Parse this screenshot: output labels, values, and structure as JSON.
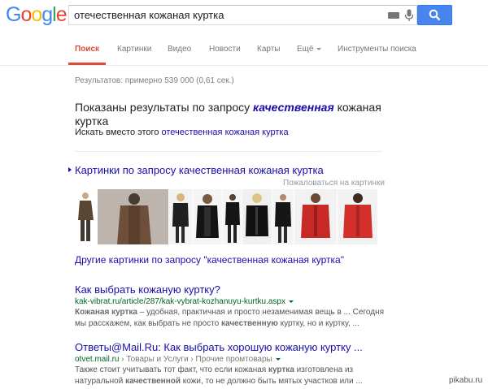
{
  "header": {
    "logo_text": "Google",
    "logo_colors": [
      "#4285f4",
      "#ea4335",
      "#fbbc05",
      "#4285f4",
      "#34a853",
      "#ea4335"
    ],
    "search_query": "отечественная кожаная куртка",
    "keyboard_icon": "keyboard-icon",
    "mic_icon": "microphone-icon",
    "search_button_icon": "magnifier-icon",
    "accent": "#4885ed"
  },
  "nav": {
    "items": [
      {
        "label": "Поиск",
        "active": true
      },
      {
        "label": "Картинки"
      },
      {
        "label": "Видео"
      },
      {
        "label": "Новости"
      },
      {
        "label": "Карты"
      },
      {
        "label": "Ещё"
      },
      {
        "label": "Инструменты поиска"
      }
    ],
    "active_color": "#dd4b39"
  },
  "stats": "Результатов: примерно 539 000 (0,61 сек.)",
  "spelling": {
    "prefix": "Показаны результаты по запросу",
    "corrected_word": "качественная",
    "suffix": "кожаная куртка",
    "instead_prefix": "Искать вместо этого",
    "instead_link": "отечественная кожаная куртка"
  },
  "images_block": {
    "title": "Картинки по запросу качественная кожаная куртка",
    "report": "Пожаловаться на картинки",
    "more_link": "Другие картинки по запросу \"качественная кожаная куртка\""
  },
  "results": [
    {
      "title": "Как выбрать кожаную куртку?",
      "url": "kak-vibrat.ru/article/287/kak-vybrat-kozhanuyu-kurtku.aspx",
      "snippet_line1_bold": "Кожаная куртка",
      "snippet_line1_rest": " – удобная, практичная и просто незаменимая вещь в ... Сегодня",
      "snippet_line2_pre": "мы расскажем, как выбрать не просто ",
      "snippet_line2_bold": "качественную",
      "snippet_line2_post": " куртку, но и куртку, ..."
    },
    {
      "title": "Ответы@Mail.Ru: Как выбрать хорошую кожаную куртку ...",
      "url": "otvet.mail.ru",
      "breadcrumb": " › Товары и Услуги › Прочие промтовары",
      "snippet_line1_pre": "Также стоит учитывать тот факт, что если кожаная ",
      "snippet_line1_bold": "куртка",
      "snippet_line1_post": " изготовлена из",
      "snippet_line2_pre": "натуральной ",
      "snippet_line2_bold": "качественной",
      "snippet_line2_post": " кожи, то не должно быть мятых участков или ..."
    }
  ],
  "watermark": "pikabu.ru"
}
